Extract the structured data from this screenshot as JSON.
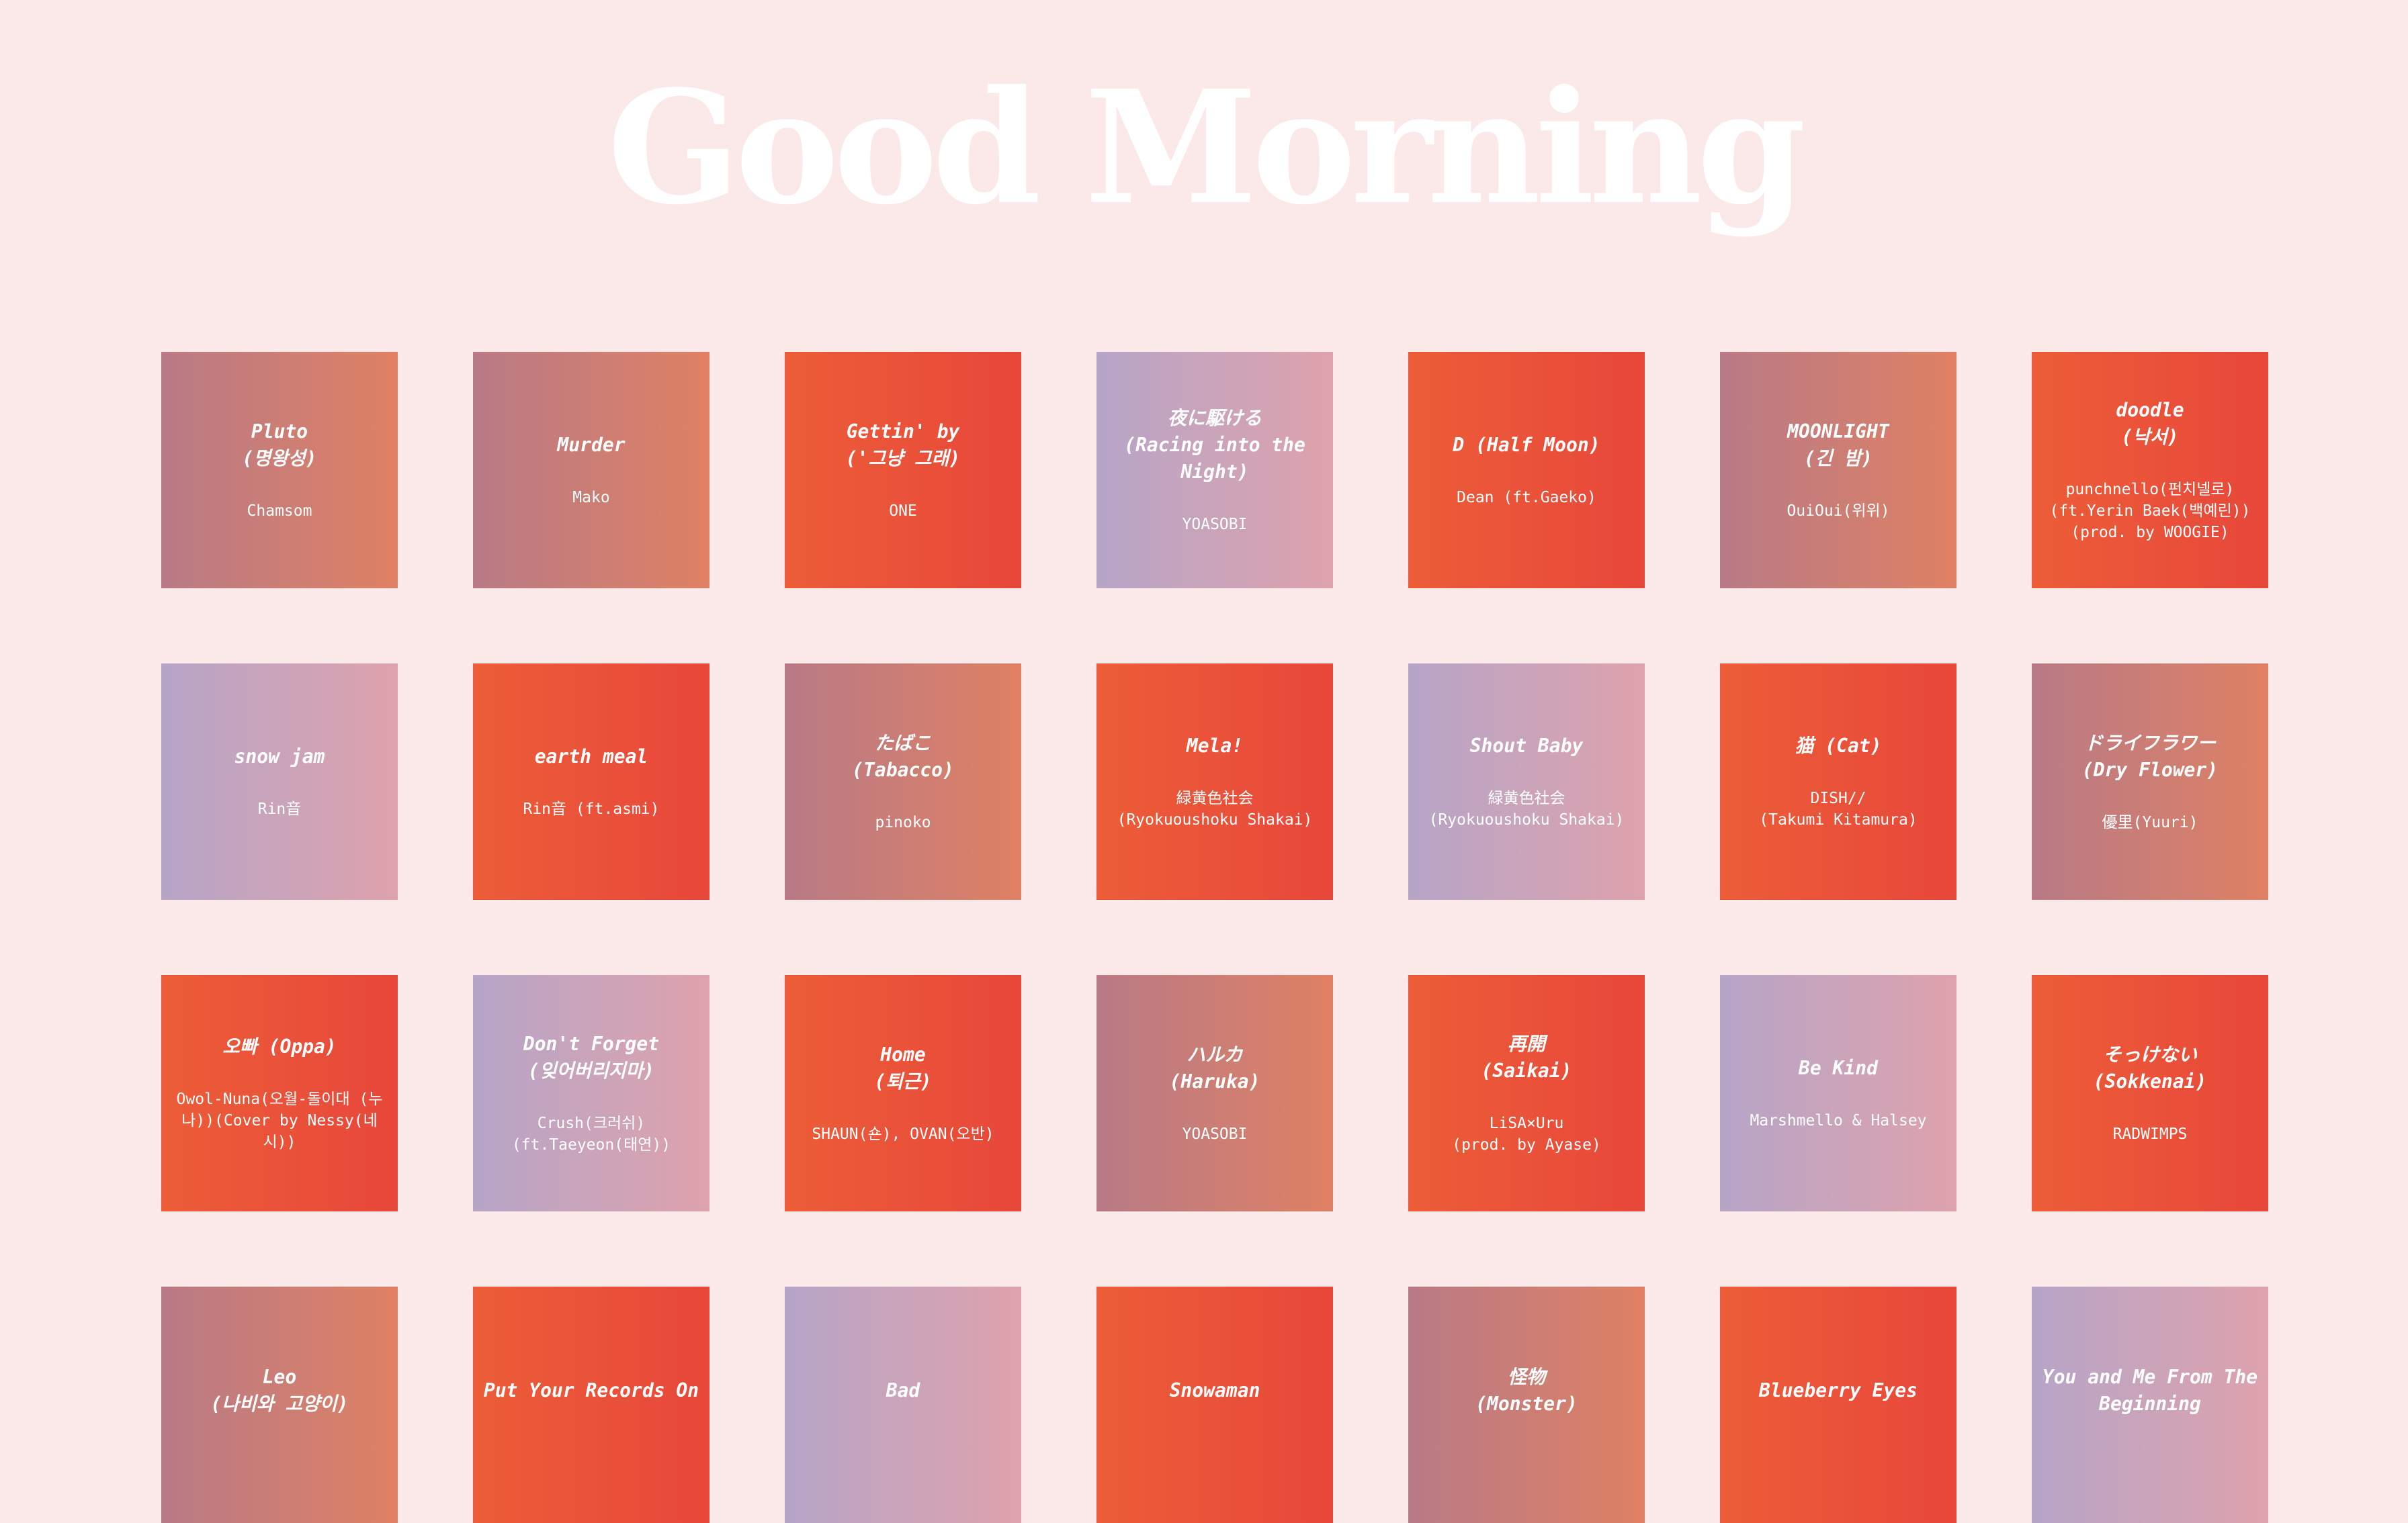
{
  "title": "Good Morning",
  "colors": {
    "background": "#fbe9e9",
    "mauve_gradient": [
      "#b87a86",
      "#df8164"
    ],
    "orange_gradient": [
      "#ec5d38",
      "#e8473a"
    ],
    "lilac_gradient": [
      "#b6a5c7",
      "#dea2ac"
    ]
  },
  "songs": [
    {
      "title": "Pluto\n(명왕성)",
      "artist": "Chamsom",
      "style": "mauve"
    },
    {
      "title": "Murder",
      "artist": "Mako",
      "style": "mauve"
    },
    {
      "title": "Gettin' by\n('그냥 그래)",
      "artist": "ONE",
      "style": "orange"
    },
    {
      "title": "夜に駆ける\n(Racing into the Night)",
      "artist": "YOASOBI",
      "style": "lilac"
    },
    {
      "title": "D (Half Moon)",
      "artist": "Dean (ft.Gaeko)",
      "style": "orange"
    },
    {
      "title": "MOONLIGHT\n(긴 밤)",
      "artist": "OuiOui(위위)",
      "style": "mauve"
    },
    {
      "title": "doodle\n(낙서)",
      "artist": "punchnello(펀치넬로)\n(ft.Yerin Baek(백예린))\n(prod. by WOOGIE)",
      "style": "orange"
    },
    {
      "title": "snow jam",
      "artist": "Rin音",
      "style": "lilac"
    },
    {
      "title": "earth meal",
      "artist": "Rin音 (ft.asmi)",
      "style": "orange"
    },
    {
      "title": "たばこ\n(Tabacco)",
      "artist": "pinoko",
      "style": "mauve"
    },
    {
      "title": "Mela!",
      "artist": "緑黄色社会\n(Ryokuoushoku Shakai)",
      "style": "orange"
    },
    {
      "title": "Shout Baby",
      "artist": "緑黄色社会\n(Ryokuoushoku Shakai)",
      "style": "lilac"
    },
    {
      "title": "猫 (Cat)",
      "artist": "DISH//\n(Takumi Kitamura)",
      "style": "orange"
    },
    {
      "title": "ドライフラワー\n(Dry Flower)",
      "artist": "優里(Yuuri)",
      "style": "mauve"
    },
    {
      "title": "오빠 (Oppa)",
      "artist": "Owol-Nuna(오월-돌이대 (누나))(Cover by Nessy(네시))",
      "style": "orange"
    },
    {
      "title": "Don't Forget\n(잊어버리지마)",
      "artist": "Crush(크러쉬)\n(ft.Taeyeon(태연))",
      "style": "lilac"
    },
    {
      "title": "Home\n(퇴근)",
      "artist": "SHAUN(숀), OVAN(오반)",
      "style": "orange"
    },
    {
      "title": "ハルカ\n(Haruka)",
      "artist": "YOASOBI",
      "style": "mauve"
    },
    {
      "title": "再開\n(Saikai)",
      "artist": "LiSA×Uru\n(prod. by Ayase)",
      "style": "orange"
    },
    {
      "title": "Be Kind",
      "artist": "Marshmello & Halsey",
      "style": "lilac"
    },
    {
      "title": "そっけない\n(Sokkenai)",
      "artist": "RADWIMPS",
      "style": "orange"
    },
    {
      "title": "Leo\n(나비와 고양이)",
      "artist": "",
      "style": "mauve"
    },
    {
      "title": "Put Your Records On",
      "artist": "",
      "style": "orange"
    },
    {
      "title": "Bad",
      "artist": "",
      "style": "lilac"
    },
    {
      "title": "Snowaman",
      "artist": "",
      "style": "orange"
    },
    {
      "title": "怪物\n(Monster)",
      "artist": "",
      "style": "mauve"
    },
    {
      "title": "Blueberry Eyes",
      "artist": "",
      "style": "orange"
    },
    {
      "title": "You and Me From The Beginning",
      "artist": "",
      "style": "lilac"
    }
  ]
}
